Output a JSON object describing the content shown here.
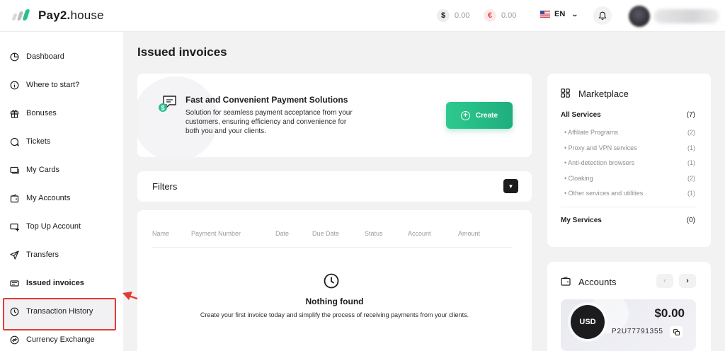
{
  "header": {
    "logo_text_bold": "Pay2.",
    "logo_text_light": "house",
    "balances": [
      {
        "symbol": "$",
        "value": "0.00",
        "icon": "dollar-icon"
      },
      {
        "symbol": "€",
        "value": "0.00",
        "icon": "euro-icon"
      }
    ],
    "language": "EN",
    "notification_icon": "bell-icon"
  },
  "sidebar": {
    "items": [
      {
        "label": "Dashboard",
        "icon": "dashboard-icon"
      },
      {
        "label": "Where to start?",
        "icon": "info-icon"
      },
      {
        "label": "Bonuses",
        "icon": "gift-icon"
      },
      {
        "label": "Tickets",
        "icon": "ticket-icon"
      },
      {
        "label": "My Cards",
        "icon": "cards-icon"
      },
      {
        "label": "My Accounts",
        "icon": "accounts-icon"
      },
      {
        "label": "Top Up Account",
        "icon": "top-up-icon"
      },
      {
        "label": "Transfers",
        "icon": "send-icon"
      },
      {
        "label": "Issued invoices",
        "icon": "invoice-icon",
        "active": true
      },
      {
        "label": "Transaction History",
        "icon": "history-icon"
      },
      {
        "label": "Currency Exchange",
        "icon": "exchange-icon"
      }
    ]
  },
  "main": {
    "title": "Issued invoices",
    "promo": {
      "heading": "Fast and Convenient Payment Solutions",
      "text": "Solution for seamless payment acceptance from your customers, ensuring efficiency and convenience for both you and your clients.",
      "button": "Create"
    },
    "filters": {
      "label": "Filters"
    },
    "table": {
      "columns": [
        "Name",
        "Payment Number",
        "Date",
        "Due Date",
        "Status",
        "Account",
        "Amount"
      ],
      "empty_title": "Nothing found",
      "empty_text": "Create your first invoice today and simplify the process of receiving payments from your clients."
    }
  },
  "marketplace": {
    "title": "Marketplace",
    "all_label": "All Services",
    "all_count": "(7)",
    "items": [
      {
        "label": "Affiliate Programs",
        "count": "(2)"
      },
      {
        "label": "Proxy and VPN services",
        "count": "(1)"
      },
      {
        "label": "Anti-detection browsers",
        "count": "(1)"
      },
      {
        "label": "Cloaking",
        "count": "(2)"
      },
      {
        "label": "Other services and utilities",
        "count": "(1)"
      }
    ],
    "my_label": "My Services",
    "my_count": "(0)"
  },
  "accounts": {
    "title": "Accounts",
    "card": {
      "currency": "USD",
      "amount": "$0.00",
      "number": "P2U77791355"
    }
  },
  "colors": {
    "accent_green": "#27c08c",
    "highlight_red": "#e53935"
  }
}
